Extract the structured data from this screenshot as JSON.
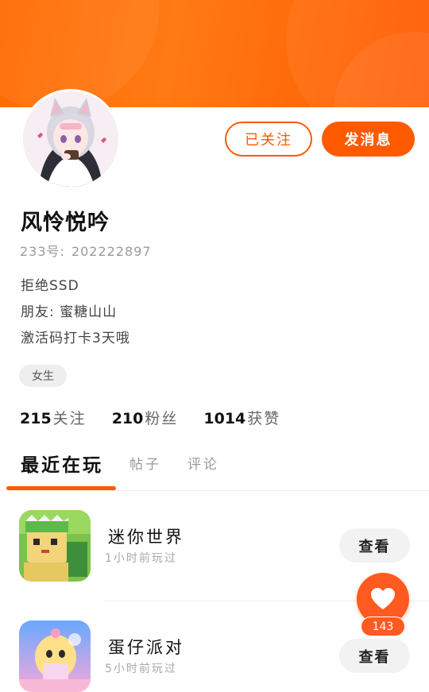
{
  "profile": {
    "name": "风怜悦吟",
    "uid_label": "233号:",
    "uid_value": "202222897",
    "bio": [
      "拒绝SSD",
      "朋友: 蜜糖山山",
      "激活码打卡3天哦"
    ],
    "gender_tag": "女生"
  },
  "actions": {
    "follow_label": "已关注",
    "message_label": "发消息"
  },
  "stats": [
    {
      "value": "215",
      "label": "关注"
    },
    {
      "value": "210",
      "label": "粉丝"
    },
    {
      "value": "1014",
      "label": "获赞"
    }
  ],
  "tabs": [
    {
      "label": "最近在玩",
      "active": true
    },
    {
      "label": "帖子",
      "active": false
    },
    {
      "label": "评论",
      "active": false
    }
  ],
  "games": [
    {
      "title": "迷你世界",
      "subtitle": "1小时前玩过",
      "button": "查看",
      "icon": "mini-world-icon"
    },
    {
      "title": "蛋仔派对",
      "subtitle": "5小时前玩过",
      "button": "查看",
      "icon": "eggy-party-icon"
    }
  ],
  "like": {
    "count": "143",
    "icon": "heart-icon"
  },
  "colors": {
    "accent": "#ff5a00",
    "banner": "#ff7a14"
  }
}
